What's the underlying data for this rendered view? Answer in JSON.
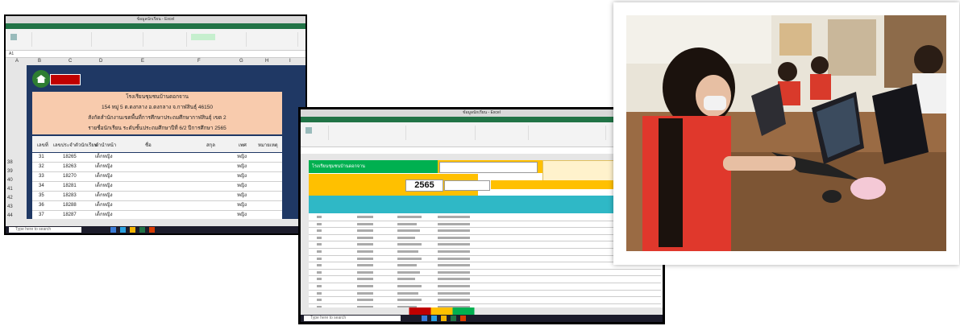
{
  "left_screenshot": {
    "window_title": "ข้อมูลนักเรียน - Excel",
    "cell_ref": "A1",
    "header_lines": [
      "โรงเรียนชุมชนบ้านดอกจาน",
      "154 หมู่ 5 ต.ดงกลาง อ.ดงกลาง จ.กาฬสินธุ์ 46150",
      "สังกัดสำนักงานเขตพื้นที่การศึกษาประถมศึกษากาฬสินธุ์ เขต 2",
      "รายชื่อนักเรียน ระดับชั้นประถมศึกษาปีที่ 6/2  ปีการศึกษา 2565"
    ],
    "columns": [
      "เลขที่",
      "เลขประจำตัวนักเรียน",
      "คำนำหน้า",
      "ชื่อ",
      "สกุล",
      "เพศ",
      "หมายเหตุ"
    ],
    "column_letters": [
      "A",
      "B",
      "C",
      "D",
      "E",
      "F",
      "G",
      "H",
      "I"
    ],
    "rows": [
      {
        "row": "38",
        "no": "31",
        "id": "18265",
        "prefix": "เด็กหญิง",
        "sex": "หญิง"
      },
      {
        "row": "39",
        "no": "32",
        "id": "18263",
        "prefix": "เด็กหญิง",
        "sex": "หญิง"
      },
      {
        "row": "40",
        "no": "33",
        "id": "18270",
        "prefix": "เด็กหญิง",
        "sex": "หญิง"
      },
      {
        "row": "41",
        "no": "34",
        "id": "18281",
        "prefix": "เด็กหญิง",
        "sex": "หญิง"
      },
      {
        "row": "42",
        "no": "35",
        "id": "18283",
        "prefix": "เด็กหญิง",
        "sex": "หญิง"
      },
      {
        "row": "43",
        "no": "36",
        "id": "18288",
        "prefix": "เด็กหญิง",
        "sex": "หญิง"
      },
      {
        "row": "44",
        "no": "37",
        "id": "18287",
        "prefix": "เด็กหญิง",
        "sex": "หญิง"
      }
    ],
    "taskbar_search": "Type here to search"
  },
  "center_screenshot": {
    "window_title": "ข้อมูลนักเรียน - Excel",
    "school_bar": "โรงเรียนชุมชนบ้านดอกจาน",
    "year": "2565",
    "taskbar_search": "Type here to search"
  },
  "photo": {
    "description_icon": "students-using-laptops-photo"
  },
  "colors": {
    "excel_green": "#217346",
    "sheet_navy": "#1f3864",
    "header_peach": "#f8cbad",
    "table_teal": "#2fb8c6",
    "bar_yellow": "#ffc000"
  }
}
